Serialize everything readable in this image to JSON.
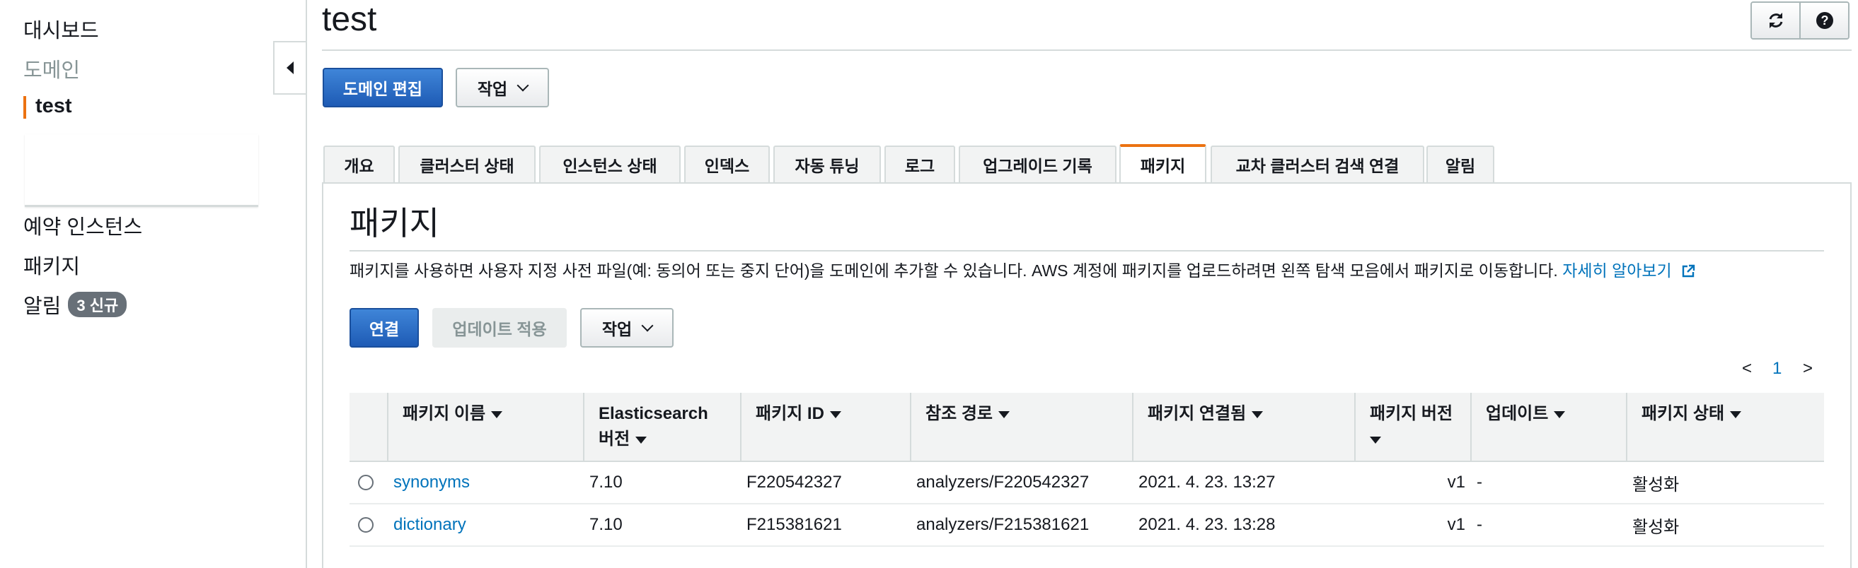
{
  "sidebar": {
    "items": [
      {
        "label": "대시보드"
      },
      {
        "label": "도메인"
      },
      {
        "label": "test"
      },
      {
        "label": "예약 인스턴스"
      },
      {
        "label": "패키지"
      },
      {
        "label": "알림",
        "badge": "3 신규"
      }
    ]
  },
  "header": {
    "title": "test",
    "edit_domain_label": "도메인 편집",
    "actions_label": "작업",
    "refresh_icon": "refresh-icon",
    "help_icon": "help-icon"
  },
  "tabs": [
    {
      "label": "개요"
    },
    {
      "label": "클러스터 상태"
    },
    {
      "label": "인스턴스 상태"
    },
    {
      "label": "인덱스"
    },
    {
      "label": "자동 튜닝"
    },
    {
      "label": "로그"
    },
    {
      "label": "업그레이드 기록"
    },
    {
      "label": "패키지",
      "active": true
    },
    {
      "label": "교차 클러스터 검색 연결"
    },
    {
      "label": "알림"
    }
  ],
  "packages": {
    "title": "패키지",
    "description": "패키지를 사용하면 사용자 지정 사전 파일(예: 동의어 또는 중지 단어)을 도메인에 추가할 수 있습니다. AWS 계정에 패키지를 업로드하려면 왼쪽 탐색 모음에서 패키지로 이동합니다.",
    "learn_more": "자세히 알아보기",
    "associate_label": "연결",
    "apply_update_label": "업데이트 적용",
    "actions_label": "작업",
    "pagination": {
      "prev": "<",
      "page": "1",
      "next": ">"
    },
    "columns": [
      {
        "label": "패키지 이름",
        "sortable": true
      },
      {
        "label": "Elasticsearch 버전",
        "sortable": true
      },
      {
        "label": "패키지 ID",
        "sortable": true
      },
      {
        "label": "참조 경로",
        "sortable": true
      },
      {
        "label": "패키지 연결됨",
        "sortable": true
      },
      {
        "label": "패키지 버전",
        "sortable": true
      },
      {
        "label": "업데이트",
        "sortable": true
      },
      {
        "label": "패키지 상태",
        "sortable": true
      }
    ],
    "rows": [
      {
        "name": "synonyms",
        "es_version": "7.10",
        "package_id": "F220542327",
        "reference_path": "analyzers/F220542327",
        "associated": "2021. 4. 23. 13:27",
        "version": "v1",
        "update": "-",
        "status": "활성화"
      },
      {
        "name": "dictionary",
        "es_version": "7.10",
        "package_id": "F215381621",
        "reference_path": "analyzers/F215381621",
        "associated": "2021. 4. 23. 13:28",
        "version": "v1",
        "update": "-",
        "status": "활성화"
      }
    ]
  },
  "colors": {
    "accent": "#ec7211",
    "primary_button": "#1e5bb5",
    "link": "#0073bb",
    "status_active": "#1d8102"
  }
}
